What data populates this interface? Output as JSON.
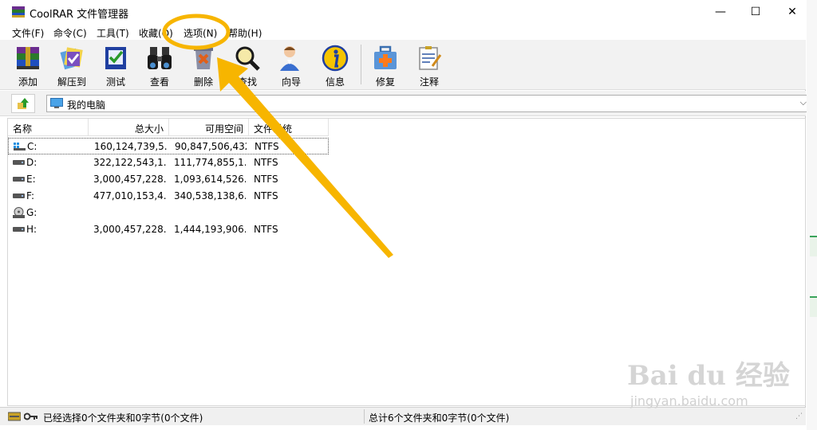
{
  "window": {
    "title": "CoolRAR 文件管理器"
  },
  "window_controls": {
    "minimize": "—",
    "maximize": "☐",
    "close": "✕"
  },
  "menu": [
    {
      "label": "文件(F)"
    },
    {
      "label": "命令(C)"
    },
    {
      "label": "工具(T)"
    },
    {
      "label": "收藏(O)"
    },
    {
      "label": "选项(N)"
    },
    {
      "label": "帮助(H)"
    }
  ],
  "toolbar": [
    {
      "label": "添加",
      "icon": "add-archive-icon"
    },
    {
      "label": "解压到",
      "icon": "extract-icon"
    },
    {
      "label": "测试",
      "icon": "test-icon"
    },
    {
      "label": "查看",
      "icon": "view-binoculars-icon"
    },
    {
      "label": "删除",
      "icon": "delete-icon"
    },
    {
      "label": "查找",
      "icon": "find-magnifier-icon"
    },
    {
      "label": "向导",
      "icon": "wizard-icon"
    },
    {
      "label": "信息",
      "icon": "info-icon"
    },
    {
      "label": "修复",
      "icon": "repair-kit-icon"
    },
    {
      "label": "注释",
      "icon": "comment-icon"
    }
  ],
  "address": {
    "path": "我的电脑"
  },
  "columns": {
    "name": "名称",
    "total_size": "总大小",
    "free_space": "可用空间",
    "fs": "文件系统"
  },
  "drives": [
    {
      "name": "C:",
      "total": "160,124,739,5...",
      "free": "90,847,506,432",
      "fs": "NTFS",
      "type": "system"
    },
    {
      "name": "D:",
      "total": "322,122,543,1...",
      "free": "111,774,855,1...",
      "fs": "NTFS",
      "type": "hdd"
    },
    {
      "name": "E:",
      "total": "3,000,457,228...",
      "free": "1,093,614,526...",
      "fs": "NTFS",
      "type": "hdd"
    },
    {
      "name": "F:",
      "total": "477,010,153,4...",
      "free": "340,538,138,6...",
      "fs": "NTFS",
      "type": "hdd"
    },
    {
      "name": "G:",
      "total": "",
      "free": "",
      "fs": "",
      "type": "cdrom"
    },
    {
      "name": "H:",
      "total": "3,000,457,228...",
      "free": "1,444,193,906...",
      "fs": "NTFS",
      "type": "hdd"
    }
  ],
  "status": {
    "selected": "已经选择0个文件夹和0字节(0个文件)",
    "total": "总计6个文件夹和0字节(0个文件)"
  },
  "watermark": {
    "main": "Bai du 经验",
    "sub": "jingyan.baidu.com"
  },
  "colors": {
    "annotation": "#f7b500",
    "toolbar_bg": "#f2f2f2"
  }
}
